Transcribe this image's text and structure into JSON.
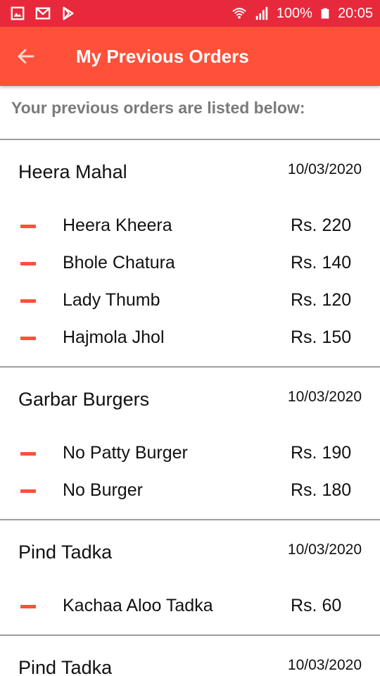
{
  "status_bar": {
    "icons_left": [
      "gallery-icon",
      "gmail-icon",
      "play-store-icon"
    ],
    "icons_right": [
      "wifi-icon",
      "signal-icon",
      "battery-icon"
    ],
    "battery": "100%",
    "time": "20:05",
    "color": "#e8293c"
  },
  "app_bar": {
    "title": "My Previous Orders",
    "back_icon": "arrow-back-icon",
    "color": "#ff5039"
  },
  "subtitle": "Your previous orders are listed below:",
  "orders": [
    {
      "restaurant": "Heera Mahal",
      "date": "10/03/2020",
      "items": [
        {
          "name": "Heera Kheera",
          "price": "Rs. 220"
        },
        {
          "name": "Bhole Chatura",
          "price": "Rs. 140"
        },
        {
          "name": "Lady Thumb",
          "price": "Rs. 120"
        },
        {
          "name": "Hajmola Jhol",
          "price": "Rs. 150"
        }
      ]
    },
    {
      "restaurant": "Garbar Burgers",
      "date": "10/03/2020",
      "items": [
        {
          "name": "No Patty Burger",
          "price": "Rs. 190"
        },
        {
          "name": "No Burger",
          "price": "Rs. 180"
        }
      ]
    },
    {
      "restaurant": "Pind Tadka",
      "date": "10/03/2020",
      "items": [
        {
          "name": "Kachaa Aloo Tadka",
          "price": "Rs. 60"
        }
      ]
    },
    {
      "restaurant": "Pind Tadka",
      "date": "10/03/2020",
      "items": []
    }
  ]
}
